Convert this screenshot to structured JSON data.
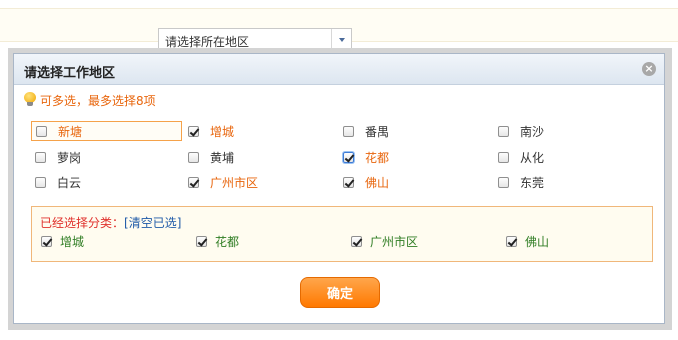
{
  "background": {
    "select_text": "请选择所在地区"
  },
  "dialog": {
    "title": "请选择工作地区",
    "close_label": "×",
    "tip": "可多选，最多选择8项"
  },
  "options": [
    {
      "label": "新塘",
      "checked": false
    },
    {
      "label": "增城",
      "checked": true
    },
    {
      "label": "番禺",
      "checked": false
    },
    {
      "label": "南沙",
      "checked": false
    },
    {
      "label": "萝岗",
      "checked": false
    },
    {
      "label": "黄埔",
      "checked": false
    },
    {
      "label": "花都",
      "checked": true
    },
    {
      "label": "从化",
      "checked": false
    },
    {
      "label": "白云",
      "checked": false
    },
    {
      "label": "广州市区",
      "checked": true
    },
    {
      "label": "佛山",
      "checked": true
    },
    {
      "label": "东莞",
      "checked": false
    }
  ],
  "selected": {
    "label": "已经选择分类：",
    "clear_label": "[清空已选]",
    "items": [
      "增城",
      "花都",
      "广州市区",
      "佛山"
    ]
  },
  "confirm_label": "确定",
  "colors": {
    "accent_orange": "#ff7900",
    "checked_label": "#e8650c",
    "selected_label": "#2f7d23",
    "clear_link": "#1f5aa8"
  }
}
